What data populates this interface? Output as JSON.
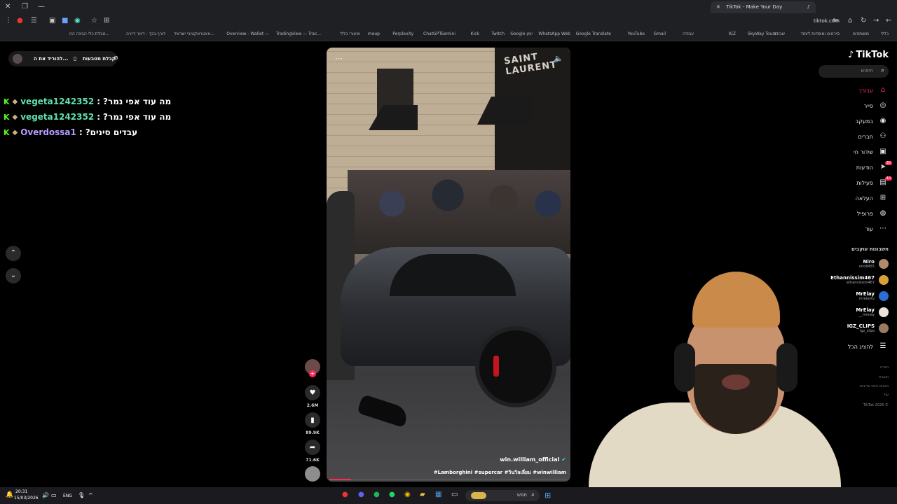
{
  "browser": {
    "tab_title": "TikTok - Make Your Day",
    "address": "tiktok.com",
    "bookmarks": [
      "כללי",
      "משותפים",
      "סירטים ומוסדות לימוד",
      "שבודה",
      "IGZ",
      "SkyWay Tours",
      "עבודה",
      "Gmail",
      "YouTube",
      "Google Translate",
      "WhatsApp Web",
      "Google יומן",
      "Twitch",
      "Kick",
      "Gemini",
      "ChatGPT",
      "Perplexity",
      "meup",
      "שיעורי כללי",
      "TradingView — Trac...",
      "Overview - Wallet —",
      "אינטראקטיבי ישראל...",
      "דורך-בכך - דיוור דיירה",
      "טבלת כלי הבינה הח..."
    ]
  },
  "tiktok": {
    "logo": "TikTok",
    "search_placeholder": "חיפוש",
    "nav": [
      "עבורך",
      "סייר",
      "במעקב",
      "חברים",
      "שידור חי",
      "הודעות",
      "פעילות",
      "העלאה",
      "פרופיל",
      "עוד"
    ],
    "badges": {
      "messages": "30",
      "activity": "40"
    },
    "following_header": "חשבונות עוקבים",
    "following": [
      {
        "name": "Niro",
        "handle": "niro8455"
      },
      {
        "name": "Ethannissim467",
        "handle": "ethannissim467"
      },
      {
        "name": "MrElay",
        "handle": "mrelaytv"
      },
      {
        "name": "MrElay",
        "handle": "__mrelay"
      },
      {
        "name": "IGZ_CLIPS",
        "handle": "igz_clips"
      }
    ],
    "show_all": "להציג הכל",
    "footer": [
      "חברה",
      "תוכנית",
      "תנאים ויחסי מדיניות",
      "עוד",
      "TikTok 2026 ©"
    ],
    "top_left_bar": {
      "coins": "קבלת מטבעות",
      "download": "להוריד את ה..."
    },
    "video": {
      "author": "win.william_official",
      "caption": "#Lamborghini #supercar #วินวิลเลี่ยม #winwilliam",
      "shop_sign": "SAINT LAURENT",
      "likes": "2.6M",
      "saves": "89.9K",
      "shares": "71.6K"
    }
  },
  "chat": [
    {
      "user": "vegeta1242352",
      "message": "?מה עוד אפי נמר",
      "user_color": "#5ee3b0"
    },
    {
      "user": "vegeta1242352",
      "message": "?מה עוד אפי נמר",
      "user_color": "#5ee3b0"
    },
    {
      "user": "Overdossa1",
      "message": "?עבדים סינים",
      "user_color": "#b69cff"
    }
  ],
  "taskbar": {
    "time": "20:31",
    "date": "15/03/2026",
    "lang": "ENG",
    "search": "חפש"
  }
}
